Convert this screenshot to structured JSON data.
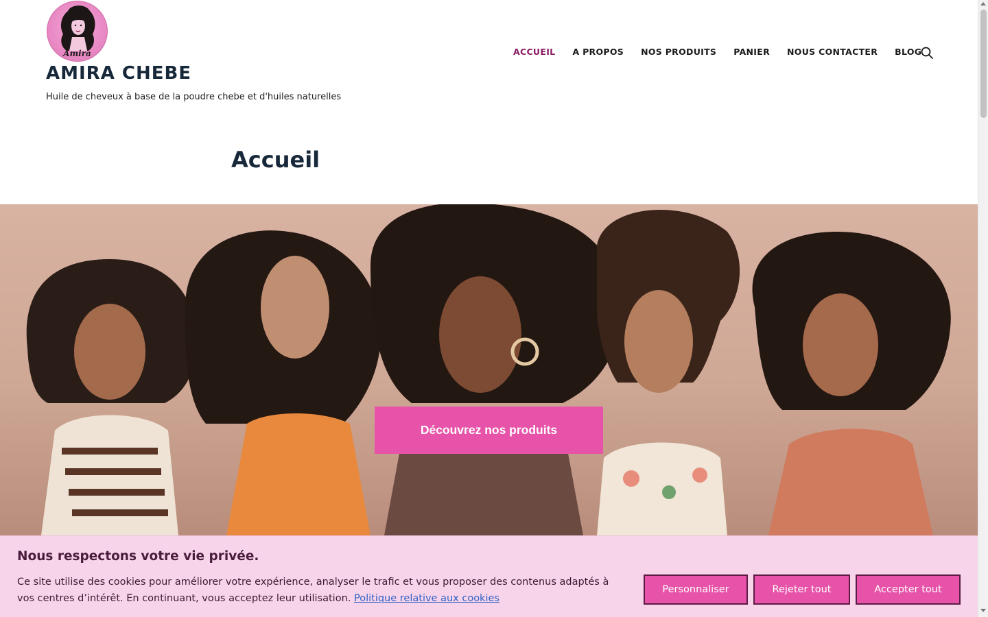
{
  "site": {
    "logo_text": "Amira",
    "title": "AMIRA CHEBE",
    "tagline": "Huile de cheveux à base de la poudre chebe et d'huiles naturelles"
  },
  "nav": {
    "items": [
      {
        "label": "ACCUEIL",
        "active": true
      },
      {
        "label": "A PROPOS",
        "active": false
      },
      {
        "label": "NOS PRODUITS",
        "active": false
      },
      {
        "label": "PANIER",
        "active": false
      },
      {
        "label": "NOUS CONTACTER",
        "active": false
      },
      {
        "label": "BLOG",
        "active": false
      }
    ],
    "search_icon": "search-icon"
  },
  "page": {
    "title": "Accueil"
  },
  "hero": {
    "image_alt": "Five women with natural afro hair",
    "cta_label": "Découvrez nos produits"
  },
  "cookie_banner": {
    "title": "Nous respectons votre vie privée.",
    "text": "Ce site utilise des cookies pour améliorer votre expérience, analyser le trafic et vous proposer des contenus adaptés à vos centres d’intérêt. En continuant, vous acceptez leur utilisation.",
    "policy_link": "Politique relative aux cookies",
    "buttons": {
      "personalize": "Personnaliser",
      "reject": "Rejeter tout",
      "accept": "Accepter tout"
    }
  },
  "colors": {
    "accent": "#e653a8",
    "nav_active": "#8a1c63",
    "banner_bg": "#f8d4ea",
    "title": "#17283a"
  }
}
